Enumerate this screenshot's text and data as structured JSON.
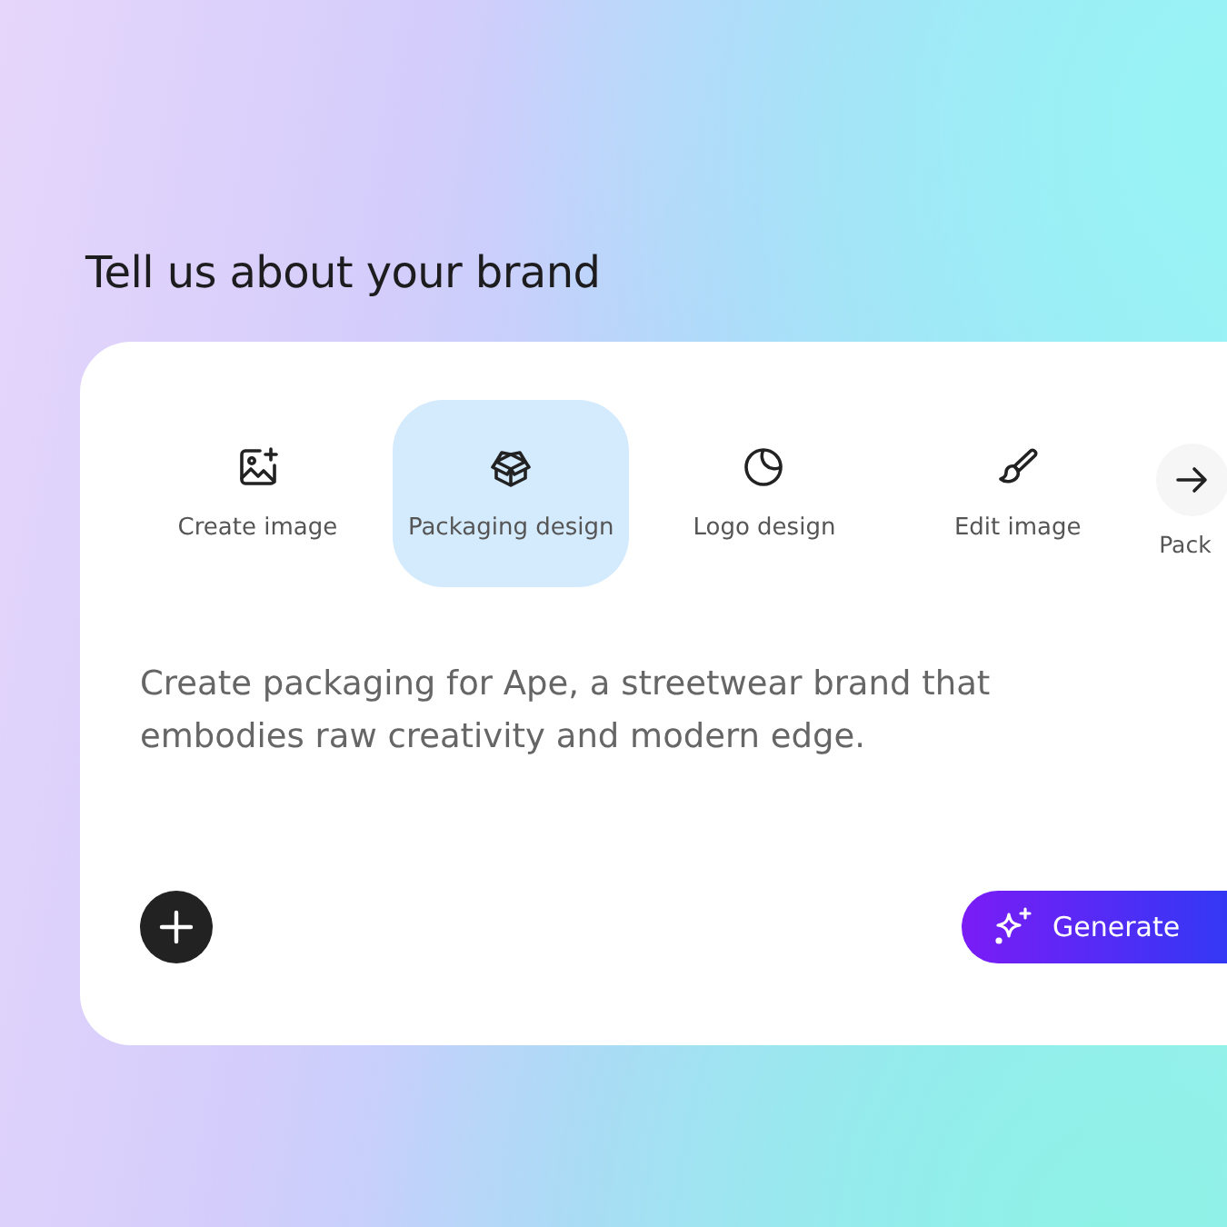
{
  "heading": "Tell us about your brand",
  "tabs": [
    {
      "kind": "image-plus",
      "label": "Create image",
      "selected": false
    },
    {
      "kind": "box",
      "label": "Packaging design",
      "selected": true
    },
    {
      "kind": "pie",
      "label": "Logo design",
      "selected": false
    },
    {
      "kind": "brush",
      "label": "Edit image",
      "selected": false
    },
    {
      "kind": "none",
      "label": "Pack",
      "selected": false
    }
  ],
  "prompt": {
    "placeholder": "Create packaging for Ape, a streetwear brand that embodies raw creativity and modern edge."
  },
  "generate_button": "Generate"
}
